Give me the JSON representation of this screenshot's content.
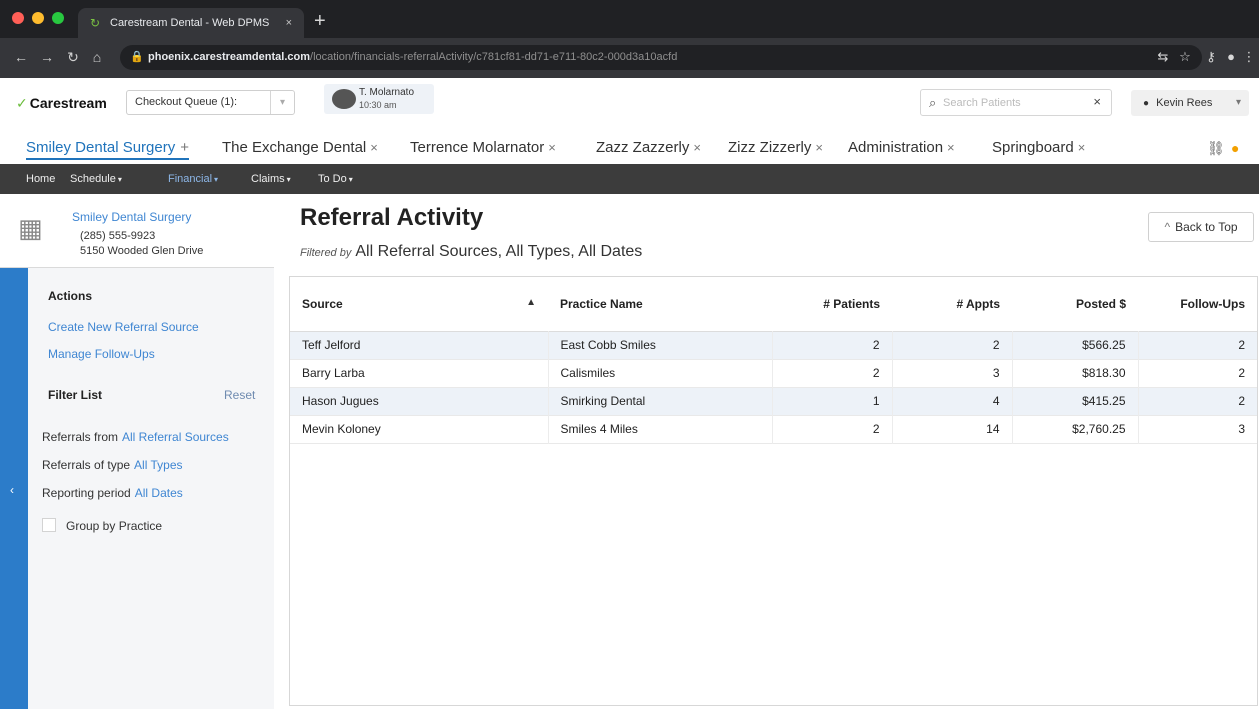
{
  "browser": {
    "tab_title": "Carestream Dental - Web DPMS",
    "tab_close": "×",
    "new_tab": "+",
    "url_host": "phoenix.carestreamdental.com",
    "url_path": "/location/financials-referralActivity/c781cf81-dd71-e711-80c2-000d3a10acfd"
  },
  "header": {
    "logo": "Carestream",
    "logo_mark": "✓",
    "checkout_queue": "Checkout Queue (1):",
    "patient_name": "T. Molarnato",
    "patient_time": "10:30 am",
    "search_placeholder": "Search Patients",
    "search_clear": "×",
    "user_name": "Kevin Rees",
    "user_caret": "▾"
  },
  "workspace_tabs": [
    {
      "label": "Smiley Dental Surgery",
      "active": true,
      "control": "+"
    },
    {
      "label": "The Exchange Dental",
      "active": false,
      "control": "×"
    },
    {
      "label": "Terrence Molarnator",
      "active": false,
      "control": "×"
    },
    {
      "label": "Zazz Zazzerly",
      "active": false,
      "control": "×"
    },
    {
      "label": "Zizz Zizzerly",
      "active": false,
      "control": "×"
    },
    {
      "label": "Administration",
      "active": false,
      "control": "×"
    },
    {
      "label": "Springboard",
      "active": false,
      "control": "×"
    }
  ],
  "menu": {
    "home": "Home",
    "schedule": "Schedule",
    "financial": "Financial",
    "claims": "Claims",
    "todo": "To Do",
    "caret": "▾"
  },
  "practice": {
    "name": "Smiley Dental Surgery",
    "phone": "(285) 555-9923",
    "address": "5150 Wooded Glen Drive"
  },
  "sidebar": {
    "actions_heading": "Actions",
    "create_source": "Create New Referral Source",
    "manage_followups": "Manage Follow-Ups",
    "filter_heading": "Filter List",
    "reset": "Reset",
    "referrals_from_label": "Referrals from",
    "referrals_from_value": "All Referral Sources",
    "referrals_type_label": "Referrals of type",
    "referrals_type_value": "All Types",
    "reporting_label": "Reporting period",
    "reporting_value": "All Dates",
    "group_by_practice": "Group by Practice",
    "collapse_arrow": "‹"
  },
  "main": {
    "title": "Referral Activity",
    "filtered_by": "Filtered by",
    "filter_summary": "All Referral Sources, All Types, All Dates",
    "back_to_top": "Back to Top",
    "back_chevron": "^"
  },
  "table": {
    "columns": {
      "source": "Source",
      "practice_name": "Practice Name",
      "patients": "# Patients",
      "appts": "# Appts",
      "posted": "Posted $",
      "followups": "Follow-Ups",
      "sort_arrow": "▲"
    },
    "rows": [
      {
        "source": "Teff Jelford",
        "practice": "East Cobb Smiles",
        "patients": "2",
        "appts": "2",
        "posted": "$566.25",
        "followups": "2"
      },
      {
        "source": "Barry Larba",
        "practice": "Calismiles",
        "patients": "2",
        "appts": "3",
        "posted": "$818.30",
        "followups": "2"
      },
      {
        "source": "Hason Jugues",
        "practice": "Smirking Dental",
        "patients": "1",
        "appts": "4",
        "posted": "$415.25",
        "followups": "2"
      },
      {
        "source": "Mevin Koloney",
        "practice": "Smiles 4 Miles",
        "patients": "2",
        "appts": "14",
        "posted": "$2,760.25",
        "followups": "3"
      }
    ]
  },
  "colors": {
    "brand_blue": "#2c7cc9",
    "link_blue": "#3f86d2",
    "menu_dark": "#3c3c3c",
    "logo_green": "#6abc3b"
  }
}
